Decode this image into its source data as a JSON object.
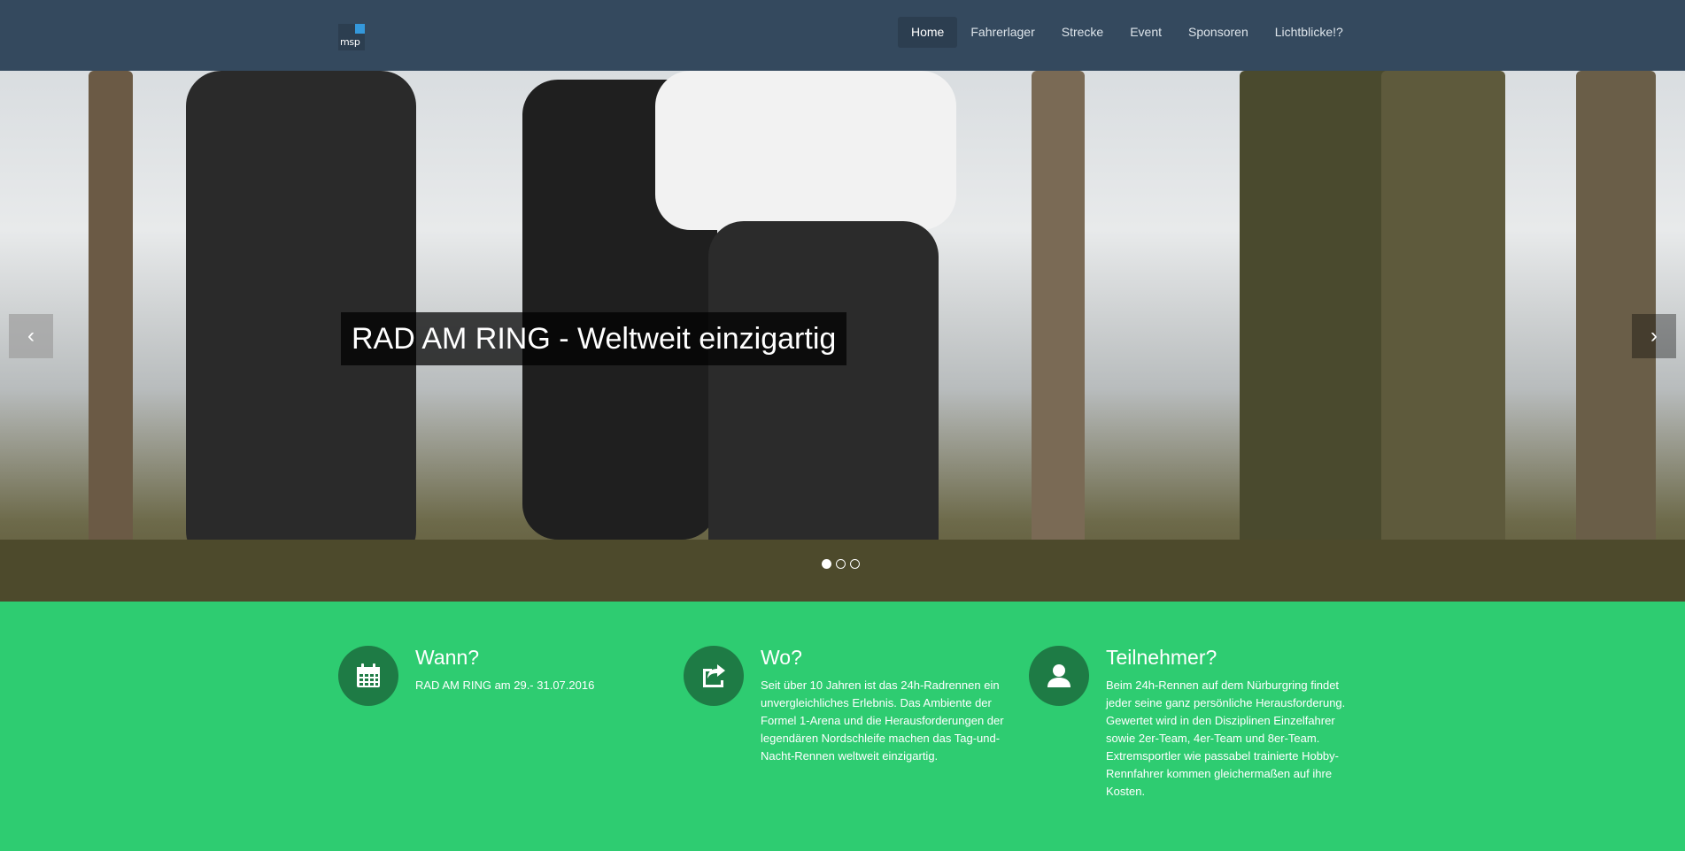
{
  "nav": {
    "logo_text": "msp",
    "items": [
      {
        "label": "Home",
        "active": true
      },
      {
        "label": "Fahrerlager",
        "active": false
      },
      {
        "label": "Strecke",
        "active": false
      },
      {
        "label": "Event",
        "active": false
      },
      {
        "label": "Sponsoren",
        "active": false
      },
      {
        "label": "Lichtblicke!?",
        "active": false
      }
    ]
  },
  "hero": {
    "caption": "RAD AM RING - Weltweit einzigartig",
    "prev_icon": "chevron-left-icon",
    "next_icon": "chevron-right-icon",
    "slides_count": 3,
    "active_slide": 1
  },
  "features": [
    {
      "icon": "calendar-icon",
      "title": "Wann?",
      "text": "RAD AM RING am 29.- 31.07.2016"
    },
    {
      "icon": "share-icon",
      "title": "Wo?",
      "text": "Seit über 10 Jahren ist das 24h-Radrennen ein unvergleichliches Erlebnis. Das Ambiente der Formel 1-Arena und die Herausforderungen der legendären Nordschleife machen das Tag-und-Nacht-Rennen weltweit einzigartig."
    },
    {
      "icon": "user-icon",
      "title": "Teilnehmer?",
      "text": "Beim 24h-Rennen auf dem Nürburgring findet jeder seine ganz persönliche Herausforderung. Gewertet wird in den Disziplinen Einzelfahrer sowie 2er-Team, 4er-Team und 8er-Team. Extremsportler wie passabel trainierte Hobby-Rennfahrer kommen gleichermaßen auf ihre Kosten."
    }
  ],
  "colors": {
    "navbar": "#34495e",
    "green": "#2ecc71",
    "icon_circle": "#1e7b45"
  }
}
